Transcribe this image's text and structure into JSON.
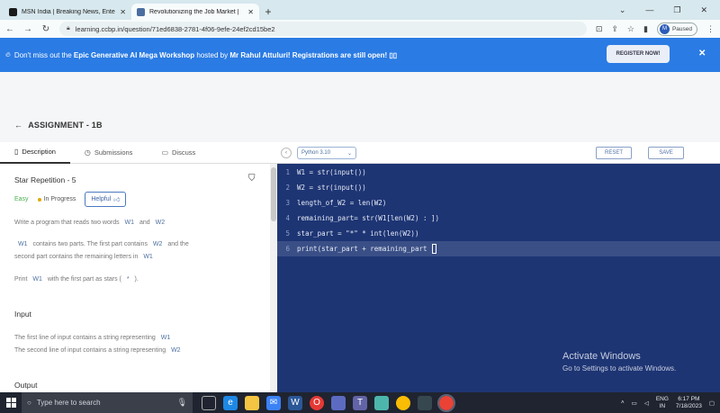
{
  "browser": {
    "tabs": [
      {
        "title": "MSN India | Breaking News, Ente",
        "close": "✕",
        "favicon_color": "#1a1a1a"
      },
      {
        "title": "Revolutionizing the Job Market |",
        "close": "✕",
        "favicon_color": "#4a6ea0"
      }
    ],
    "new_tab": "+",
    "window_controls": {
      "dropdown": "⌄",
      "minimize": "—",
      "restore": "❐",
      "close": "✕"
    },
    "url": "learning.ccbp.in/question/71ed6838-2781-4f06-9efe-24ef2cd15be2",
    "profile_initial": "M",
    "profile_status": "Paused"
  },
  "banner": {
    "text_prefix": "Don't miss out the",
    "workshop": "Epic Generative AI Mega Workshop",
    "text_mid": "hosted by",
    "host": "Mr Rahul Attuluri! Registrations are still open! ▯▯",
    "register_label": "REGISTER NOW!",
    "close": "✕",
    "color": "#2a7be4"
  },
  "header": {
    "back_arrow": "←",
    "title": "ASSIGNMENT - 1B"
  },
  "left_tabs": [
    {
      "label": "Description",
      "icon": "▯"
    },
    {
      "label": "Submissions",
      "icon": "◷"
    },
    {
      "label": "Discuss",
      "icon": "▭"
    }
  ],
  "editor_toolbar": {
    "collapse": "‹",
    "language": "Python 3.10",
    "reset_label": "RESET",
    "save_label": "SAVE"
  },
  "question": {
    "title": "Star Repetition - 5",
    "difficulty": "Easy",
    "status": "In Progress",
    "helpful_label": "Helpful",
    "desc1_a": "Write a program that reads two words",
    "desc1_w1": "W1",
    "desc1_and": "and",
    "desc1_w2": "W2",
    "desc2_w1": "W1",
    "desc2_a": "contains two parts. The first part contains",
    "desc2_w2": "W2",
    "desc2_b": "and the",
    "desc3_a": "second part contains the remaining letters in",
    "desc3_w1": "W1",
    "desc4_a": "Print",
    "desc4_w1": "W1",
    "desc4_b": "with the first part as stars (",
    "desc4_star": "*",
    "desc4_c": ").",
    "input_heading": "Input",
    "input1_a": "The first line of input contains a string representing",
    "input1_w": "W1",
    "input2_a": "The second line of input contains a string representing",
    "input2_w": "W2",
    "output_heading": "Output"
  },
  "code_lines": [
    {
      "n": "1",
      "code": "W1 = str(input())"
    },
    {
      "n": "2",
      "code": "W2 = str(input())"
    },
    {
      "n": "3",
      "code": "length_of_W2 = len(W2)"
    },
    {
      "n": "4",
      "code": "remaining_part= str(W1[len(W2) : ])"
    },
    {
      "n": "5",
      "code": "star_part = \"*\" * int(len(W2))"
    },
    {
      "n": "6",
      "code": "print(star_part + remaining_part "
    }
  ],
  "watermark": {
    "line1": "Activate Windows",
    "line2": "Go to Settings to activate Windows."
  },
  "taskbar": {
    "search_placeholder": "Type here to search",
    "icons": [
      "task-view-icon",
      "edge-icon",
      "file-explorer-icon",
      "mail-icon",
      "word-icon",
      "opera-icon",
      "store-icon",
      "teams-icon",
      "photos-icon",
      "chrome-icon",
      "media-icon",
      "chrome-active-icon"
    ],
    "lang_top": "ENG",
    "lang_bottom": "IN",
    "time": "6:17 PM",
    "date": "7/18/2023"
  }
}
